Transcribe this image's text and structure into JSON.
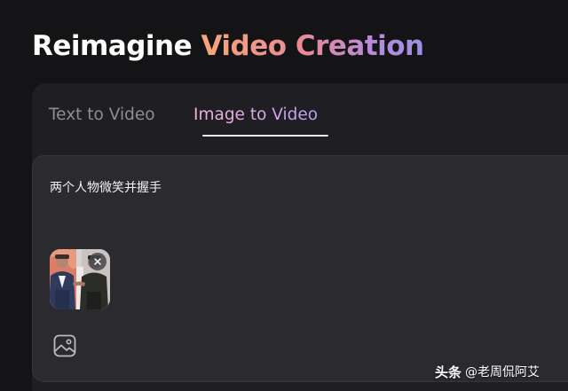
{
  "headline": {
    "plain": "Reimagine ",
    "highlight": "Video Creation"
  },
  "tabs": [
    {
      "label": "Text to Video",
      "active": false
    },
    {
      "label": "Image to Video",
      "active": true
    }
  ],
  "editor": {
    "prompt_text": "两个人物微笑并握手",
    "image_thumbnail": "uploaded-photo-two-men",
    "remove_icon": "close-icon",
    "upload_icon": "image-icon"
  },
  "watermark": {
    "brand": "头条",
    "handle": "@老周侃阿艾"
  },
  "colors": {
    "background": "#141416",
    "panel": "#1f1f23",
    "editor": "#2a2a2f",
    "accent_gradient": [
      "#f7a777",
      "#ea8a95",
      "#b98ad6",
      "#9c8fe6"
    ]
  }
}
